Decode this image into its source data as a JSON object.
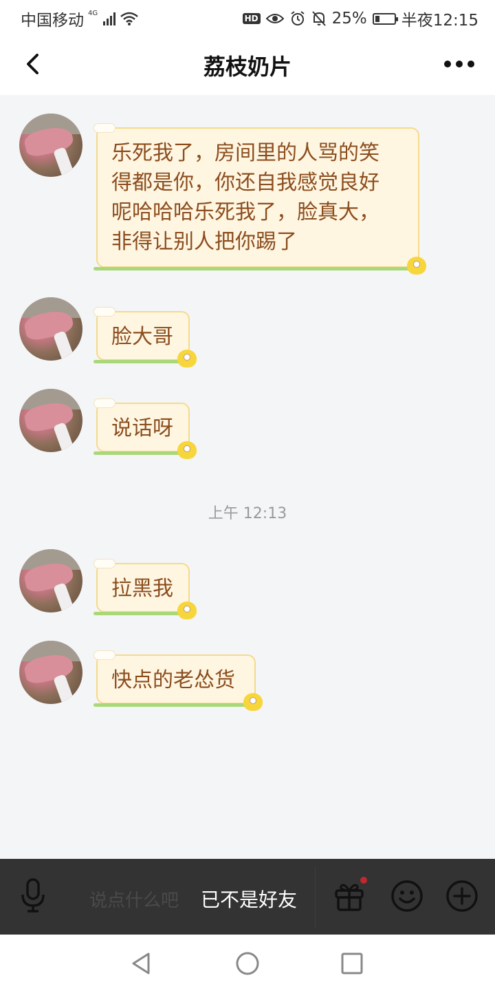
{
  "status_bar": {
    "carrier": "中国移动",
    "network": "4G",
    "hd_badge": "HD",
    "battery": "25%",
    "battery_level": 0.25,
    "time": "半夜12:15"
  },
  "header": {
    "title": "荔枝奶片"
  },
  "messages": [
    {
      "sender": "other",
      "text_lines": [
        "乐死我了，房间里的人骂的笑",
        "得都是你，你还自我感觉良好",
        "呢哈哈哈乐死我了，脸真大，",
        "非得让别人把你踢了"
      ]
    },
    {
      "sender": "other",
      "text_lines": [
        "脸大哥"
      ]
    },
    {
      "sender": "other",
      "text_lines": [
        "说话呀"
      ]
    },
    {
      "sender": "other",
      "text_lines": [
        "拉黑我"
      ]
    },
    {
      "sender": "other",
      "text_lines": [
        "快点的老怂货"
      ]
    }
  ],
  "time_separator": "上午 12:13",
  "input_bar": {
    "placeholder": "说点什么吧",
    "notice": "已不是好友"
  },
  "icons": {
    "mic": "mic-icon",
    "gift": "gift-icon",
    "emoji": "emoji-icon",
    "add": "add-icon",
    "back": "back-icon",
    "more": "more-icon"
  },
  "colors": {
    "bubble_bg": "#fff6e2",
    "bubble_border": "#f6d98a",
    "bubble_text": "#8b4d1e",
    "input_bar_bg": "#333333",
    "gift_badge": "#c0282d"
  }
}
